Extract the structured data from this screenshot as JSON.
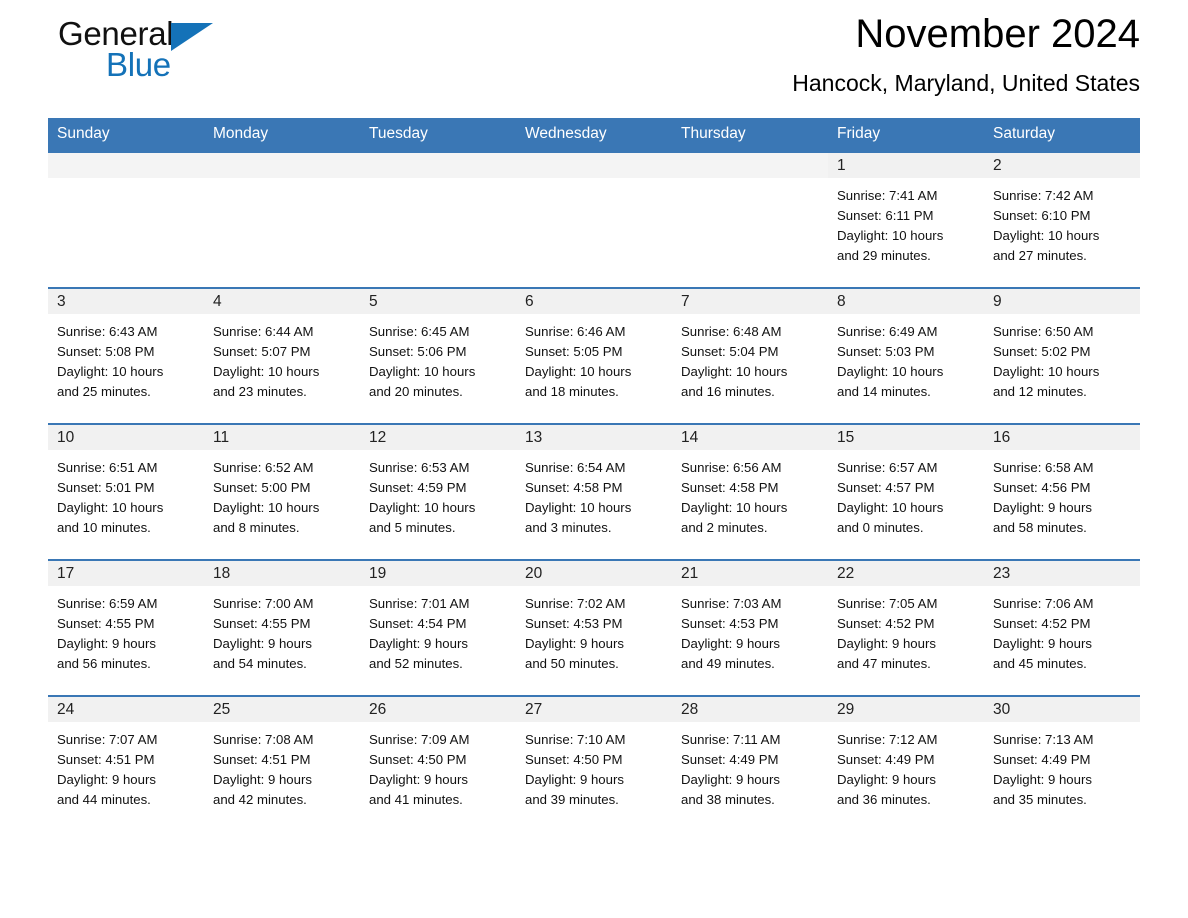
{
  "brand": {
    "name_part1": "General",
    "name_part2": "Blue",
    "triangle_color": "#1472b8"
  },
  "header": {
    "month_title": "November 2024",
    "location": "Hancock, Maryland, United States",
    "accent_color": "#3a77b5"
  },
  "calendar": {
    "weekday_headers": [
      "Sunday",
      "Monday",
      "Tuesday",
      "Wednesday",
      "Thursday",
      "Friday",
      "Saturday"
    ],
    "weeks": [
      [
        {
          "day": "",
          "sunrise": "",
          "sunset": "",
          "daylight_line1": "",
          "daylight_line2": "",
          "empty": true
        },
        {
          "day": "",
          "sunrise": "",
          "sunset": "",
          "daylight_line1": "",
          "daylight_line2": "",
          "empty": true
        },
        {
          "day": "",
          "sunrise": "",
          "sunset": "",
          "daylight_line1": "",
          "daylight_line2": "",
          "empty": true
        },
        {
          "day": "",
          "sunrise": "",
          "sunset": "",
          "daylight_line1": "",
          "daylight_line2": "",
          "empty": true
        },
        {
          "day": "",
          "sunrise": "",
          "sunset": "",
          "daylight_line1": "",
          "daylight_line2": "",
          "empty": true
        },
        {
          "day": "1",
          "sunrise": "Sunrise: 7:41 AM",
          "sunset": "Sunset: 6:11 PM",
          "daylight_line1": "Daylight: 10 hours",
          "daylight_line2": "and 29 minutes."
        },
        {
          "day": "2",
          "sunrise": "Sunrise: 7:42 AM",
          "sunset": "Sunset: 6:10 PM",
          "daylight_line1": "Daylight: 10 hours",
          "daylight_line2": "and 27 minutes."
        }
      ],
      [
        {
          "day": "3",
          "sunrise": "Sunrise: 6:43 AM",
          "sunset": "Sunset: 5:08 PM",
          "daylight_line1": "Daylight: 10 hours",
          "daylight_line2": "and 25 minutes."
        },
        {
          "day": "4",
          "sunrise": "Sunrise: 6:44 AM",
          "sunset": "Sunset: 5:07 PM",
          "daylight_line1": "Daylight: 10 hours",
          "daylight_line2": "and 23 minutes."
        },
        {
          "day": "5",
          "sunrise": "Sunrise: 6:45 AM",
          "sunset": "Sunset: 5:06 PM",
          "daylight_line1": "Daylight: 10 hours",
          "daylight_line2": "and 20 minutes."
        },
        {
          "day": "6",
          "sunrise": "Sunrise: 6:46 AM",
          "sunset": "Sunset: 5:05 PM",
          "daylight_line1": "Daylight: 10 hours",
          "daylight_line2": "and 18 minutes."
        },
        {
          "day": "7",
          "sunrise": "Sunrise: 6:48 AM",
          "sunset": "Sunset: 5:04 PM",
          "daylight_line1": "Daylight: 10 hours",
          "daylight_line2": "and 16 minutes."
        },
        {
          "day": "8",
          "sunrise": "Sunrise: 6:49 AM",
          "sunset": "Sunset: 5:03 PM",
          "daylight_line1": "Daylight: 10 hours",
          "daylight_line2": "and 14 minutes."
        },
        {
          "day": "9",
          "sunrise": "Sunrise: 6:50 AM",
          "sunset": "Sunset: 5:02 PM",
          "daylight_line1": "Daylight: 10 hours",
          "daylight_line2": "and 12 minutes."
        }
      ],
      [
        {
          "day": "10",
          "sunrise": "Sunrise: 6:51 AM",
          "sunset": "Sunset: 5:01 PM",
          "daylight_line1": "Daylight: 10 hours",
          "daylight_line2": "and 10 minutes."
        },
        {
          "day": "11",
          "sunrise": "Sunrise: 6:52 AM",
          "sunset": "Sunset: 5:00 PM",
          "daylight_line1": "Daylight: 10 hours",
          "daylight_line2": "and 8 minutes."
        },
        {
          "day": "12",
          "sunrise": "Sunrise: 6:53 AM",
          "sunset": "Sunset: 4:59 PM",
          "daylight_line1": "Daylight: 10 hours",
          "daylight_line2": "and 5 minutes."
        },
        {
          "day": "13",
          "sunrise": "Sunrise: 6:54 AM",
          "sunset": "Sunset: 4:58 PM",
          "daylight_line1": "Daylight: 10 hours",
          "daylight_line2": "and 3 minutes."
        },
        {
          "day": "14",
          "sunrise": "Sunrise: 6:56 AM",
          "sunset": "Sunset: 4:58 PM",
          "daylight_line1": "Daylight: 10 hours",
          "daylight_line2": "and 2 minutes."
        },
        {
          "day": "15",
          "sunrise": "Sunrise: 6:57 AM",
          "sunset": "Sunset: 4:57 PM",
          "daylight_line1": "Daylight: 10 hours",
          "daylight_line2": "and 0 minutes."
        },
        {
          "day": "16",
          "sunrise": "Sunrise: 6:58 AM",
          "sunset": "Sunset: 4:56 PM",
          "daylight_line1": "Daylight: 9 hours",
          "daylight_line2": "and 58 minutes."
        }
      ],
      [
        {
          "day": "17",
          "sunrise": "Sunrise: 6:59 AM",
          "sunset": "Sunset: 4:55 PM",
          "daylight_line1": "Daylight: 9 hours",
          "daylight_line2": "and 56 minutes."
        },
        {
          "day": "18",
          "sunrise": "Sunrise: 7:00 AM",
          "sunset": "Sunset: 4:55 PM",
          "daylight_line1": "Daylight: 9 hours",
          "daylight_line2": "and 54 minutes."
        },
        {
          "day": "19",
          "sunrise": "Sunrise: 7:01 AM",
          "sunset": "Sunset: 4:54 PM",
          "daylight_line1": "Daylight: 9 hours",
          "daylight_line2": "and 52 minutes."
        },
        {
          "day": "20",
          "sunrise": "Sunrise: 7:02 AM",
          "sunset": "Sunset: 4:53 PM",
          "daylight_line1": "Daylight: 9 hours",
          "daylight_line2": "and 50 minutes."
        },
        {
          "day": "21",
          "sunrise": "Sunrise: 7:03 AM",
          "sunset": "Sunset: 4:53 PM",
          "daylight_line1": "Daylight: 9 hours",
          "daylight_line2": "and 49 minutes."
        },
        {
          "day": "22",
          "sunrise": "Sunrise: 7:05 AM",
          "sunset": "Sunset: 4:52 PM",
          "daylight_line1": "Daylight: 9 hours",
          "daylight_line2": "and 47 minutes."
        },
        {
          "day": "23",
          "sunrise": "Sunrise: 7:06 AM",
          "sunset": "Sunset: 4:52 PM",
          "daylight_line1": "Daylight: 9 hours",
          "daylight_line2": "and 45 minutes."
        }
      ],
      [
        {
          "day": "24",
          "sunrise": "Sunrise: 7:07 AM",
          "sunset": "Sunset: 4:51 PM",
          "daylight_line1": "Daylight: 9 hours",
          "daylight_line2": "and 44 minutes."
        },
        {
          "day": "25",
          "sunrise": "Sunrise: 7:08 AM",
          "sunset": "Sunset: 4:51 PM",
          "daylight_line1": "Daylight: 9 hours",
          "daylight_line2": "and 42 minutes."
        },
        {
          "day": "26",
          "sunrise": "Sunrise: 7:09 AM",
          "sunset": "Sunset: 4:50 PM",
          "daylight_line1": "Daylight: 9 hours",
          "daylight_line2": "and 41 minutes."
        },
        {
          "day": "27",
          "sunrise": "Sunrise: 7:10 AM",
          "sunset": "Sunset: 4:50 PM",
          "daylight_line1": "Daylight: 9 hours",
          "daylight_line2": "and 39 minutes."
        },
        {
          "day": "28",
          "sunrise": "Sunrise: 7:11 AM",
          "sunset": "Sunset: 4:49 PM",
          "daylight_line1": "Daylight: 9 hours",
          "daylight_line2": "and 38 minutes."
        },
        {
          "day": "29",
          "sunrise": "Sunrise: 7:12 AM",
          "sunset": "Sunset: 4:49 PM",
          "daylight_line1": "Daylight: 9 hours",
          "daylight_line2": "and 36 minutes."
        },
        {
          "day": "30",
          "sunrise": "Sunrise: 7:13 AM",
          "sunset": "Sunset: 4:49 PM",
          "daylight_line1": "Daylight: 9 hours",
          "daylight_line2": "and 35 minutes."
        }
      ]
    ]
  }
}
